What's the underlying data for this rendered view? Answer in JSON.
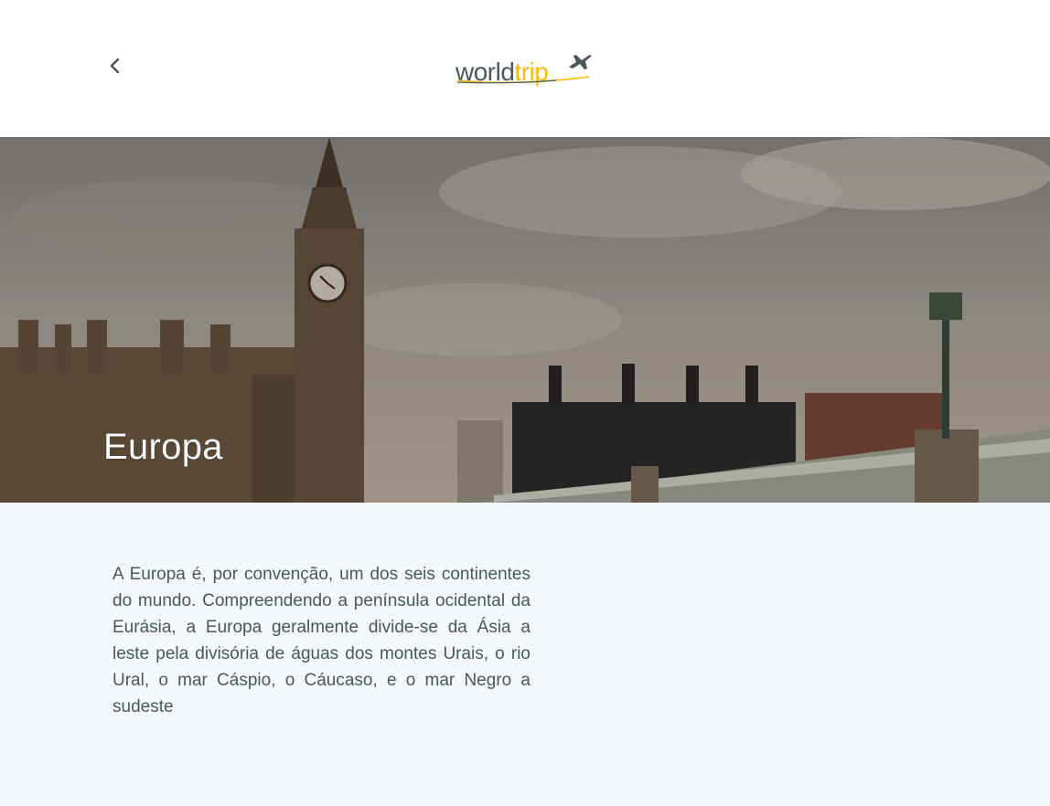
{
  "header": {
    "back_icon": "chevron-left-icon",
    "logo": {
      "word_part": "world",
      "accent_part": "trip",
      "icon": "airplane-icon"
    }
  },
  "banner": {
    "title": "Europa",
    "image": "london-big-ben-westminster-photo"
  },
  "content": {
    "description": "A Europa é, por convenção, um dos seis continentes do mundo. Compreendendo a península ocidental da Eurásia, a Europa geralmente divide-se da Ásia a leste pela divisória de águas dos montes Urais, o rio Ural, o mar Cáspio, o Cáucaso, e o mar Negro a sudeste"
  },
  "colors": {
    "accent": "#FFBA08",
    "text": "#47585B",
    "background": "#F5F8FA",
    "header_bg": "#FFFFFF",
    "title_light": "#F5F8FA"
  }
}
